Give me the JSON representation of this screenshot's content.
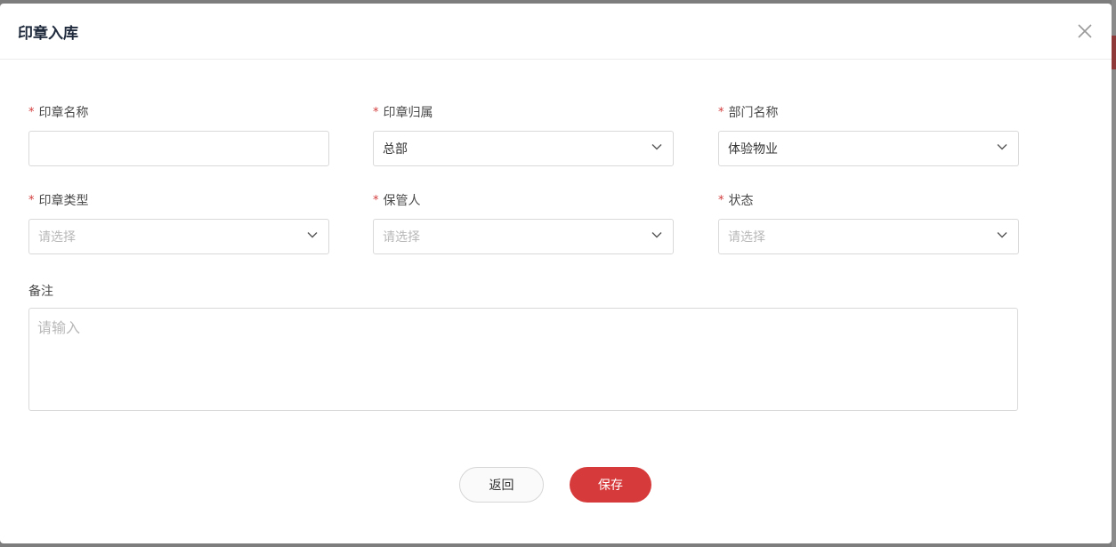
{
  "dialog": {
    "title": "印章入库"
  },
  "fields": [
    {
      "label": "印章名称",
      "required": true,
      "type": "input",
      "value": "",
      "placeholder": ""
    },
    {
      "label": "印章归属",
      "required": true,
      "type": "select",
      "value": "总部",
      "placeholder": ""
    },
    {
      "label": "部门名称",
      "required": true,
      "type": "select",
      "value": "体验物业",
      "placeholder": ""
    },
    {
      "label": "印章类型",
      "required": true,
      "type": "select",
      "value": "",
      "placeholder": "请选择"
    },
    {
      "label": "保管人",
      "required": true,
      "type": "select",
      "value": "",
      "placeholder": "请选择"
    },
    {
      "label": "状态",
      "required": true,
      "type": "select",
      "value": "",
      "placeholder": "请选择"
    }
  ],
  "remark": {
    "label": "备注",
    "placeholder": "请输入"
  },
  "buttons": {
    "back": "返回",
    "save": "保存"
  },
  "colors": {
    "primary": "#d73a3a",
    "required": "#d23b3b",
    "title": "#1f2a3c"
  },
  "icons": {
    "close": "close-icon",
    "dropdown": "chevron-down-icon"
  }
}
